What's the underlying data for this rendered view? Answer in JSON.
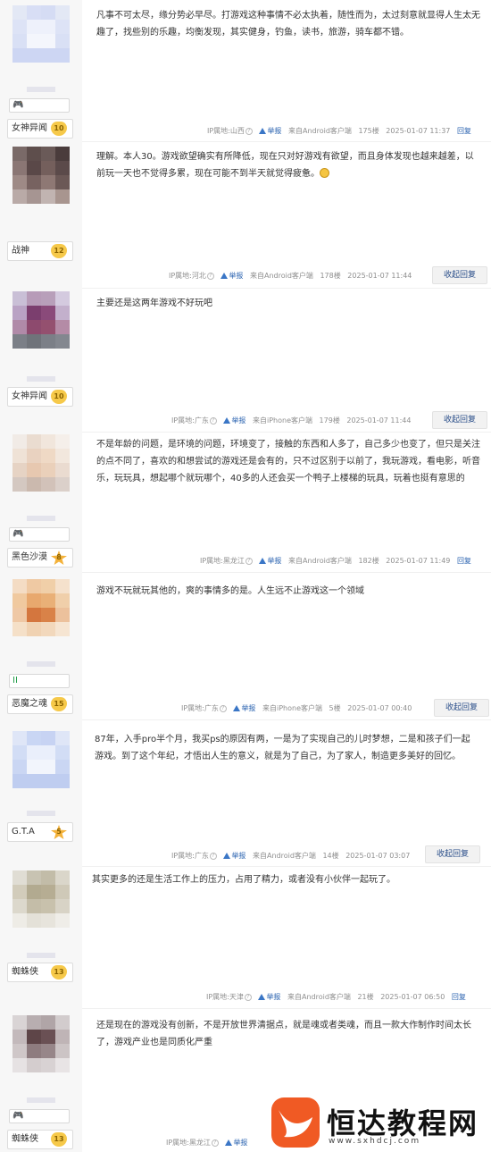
{
  "posts": [
    {
      "user": "女神异闻",
      "level": "10",
      "level_shape": "heart",
      "badge": "🎮",
      "content": "凡事不可太尽，缘分势必早尽。打游戏这种事情不必太执着，随性而为，太过刻意就显得人生太无趣了，找些别的乐趣，均衡发现，其实健身，钓鱼，读书，旅游，骑车都不错。",
      "ip": "IP属地:山西",
      "report": "举报",
      "client": "来自Android客户端",
      "floor": "175楼",
      "time": "2025-01-07 11:37",
      "reply": "回复"
    },
    {
      "user": "战神",
      "level": "12",
      "level_shape": "heart",
      "badge": "",
      "content": "理解。本人30。游戏欲望确实有所降低，现在只对好游戏有欲望，而且身体发现也越来越差，以前玩一天也不觉得多累，现在可能不到半天就觉得疲惫。",
      "ip": "IP属地:河北",
      "report": "举报",
      "client": "来自Android客户端",
      "floor": "178楼",
      "time": "2025-01-07 11:44",
      "reply": "收起回复"
    },
    {
      "user": "女神异闻",
      "level": "10",
      "level_shape": "heart",
      "badge": "",
      "content": "主要还是这两年游戏不好玩吧",
      "ip": "IP属地:广东",
      "report": "举报",
      "client": "来自iPhone客户端",
      "floor": "179楼",
      "time": "2025-01-07 11:44",
      "reply": "收起回复"
    },
    {
      "user": "黑色沙漠",
      "level": "8",
      "level_shape": "star",
      "badge": "🎮",
      "content": "不是年龄的问题，是环境的问题，环境变了，接触的东西和人多了，自己多少也变了，但只是关注的点不同了，喜欢的和想尝试的游戏还是会有的，只不过区别于以前了，我玩游戏，看电影，听音乐，玩玩具，想起哪个就玩哪个，40多的人还会买一个鸭子上楼梯的玩具，玩着也挺有意思的",
      "ip": "IP属地:黑龙江",
      "report": "举报",
      "client": "来自Android客户端",
      "floor": "182楼",
      "time": "2025-01-07 11:49",
      "reply": "回复"
    },
    {
      "user": "恶魔之魂",
      "level": "15",
      "level_shape": "heart",
      "badge": "II",
      "content": "游戏不玩就玩其他的，爽的事情多的是。人生远不止游戏这一个领域",
      "ip": "IP属地:广东",
      "report": "举报",
      "client": "来自iPhone客户端",
      "floor": "5楼",
      "time": "2025-01-07 00:40",
      "reply": "收起回复"
    },
    {
      "user": "G.T.A",
      "level": "5",
      "level_shape": "star",
      "badge": "",
      "content": "87年，入手pro半个月，我买ps的原因有两，一是为了实现自己的儿时梦想，二是和孩子们一起游戏。到了这个年纪，才悟出人生的意义，就是为了自己，为了家人，制造更多美好的回忆。",
      "ip": "IP属地:广东",
      "report": "举报",
      "client": "来自Android客户端",
      "floor": "14楼",
      "time": "2025-01-07 03:07",
      "reply": "收起回复"
    },
    {
      "user": "蜘蛛侠",
      "level": "13",
      "level_shape": "heart",
      "badge": "",
      "content": "其实更多的还是生活工作上的压力，占用了精力，或者没有小伙伴一起玩了。",
      "ip": "IP属地:天津",
      "report": "举报",
      "client": "来自Android客户端",
      "floor": "21楼",
      "time": "2025-01-07 06:50",
      "reply": "回复"
    },
    {
      "user": "蜘蛛侠",
      "level": "13",
      "level_shape": "heart",
      "badge": "🎮",
      "content": "还是现在的游戏没有创新，不是开放世界清据点，就是魂或者类魂，而且一款大作制作时间太长了，游戏产业也是同质化严重",
      "ip": "IP属地:黑龙江",
      "report": "举报",
      "client": "",
      "floor": "",
      "time": "",
      "reply": ""
    }
  ],
  "watermark": {
    "name": "恒达教程网",
    "url": "www.sxhdcj.com"
  },
  "colors": {
    "link": "#2b63b0",
    "meta": "#8f8f8f",
    "logo": "#f05a24"
  }
}
